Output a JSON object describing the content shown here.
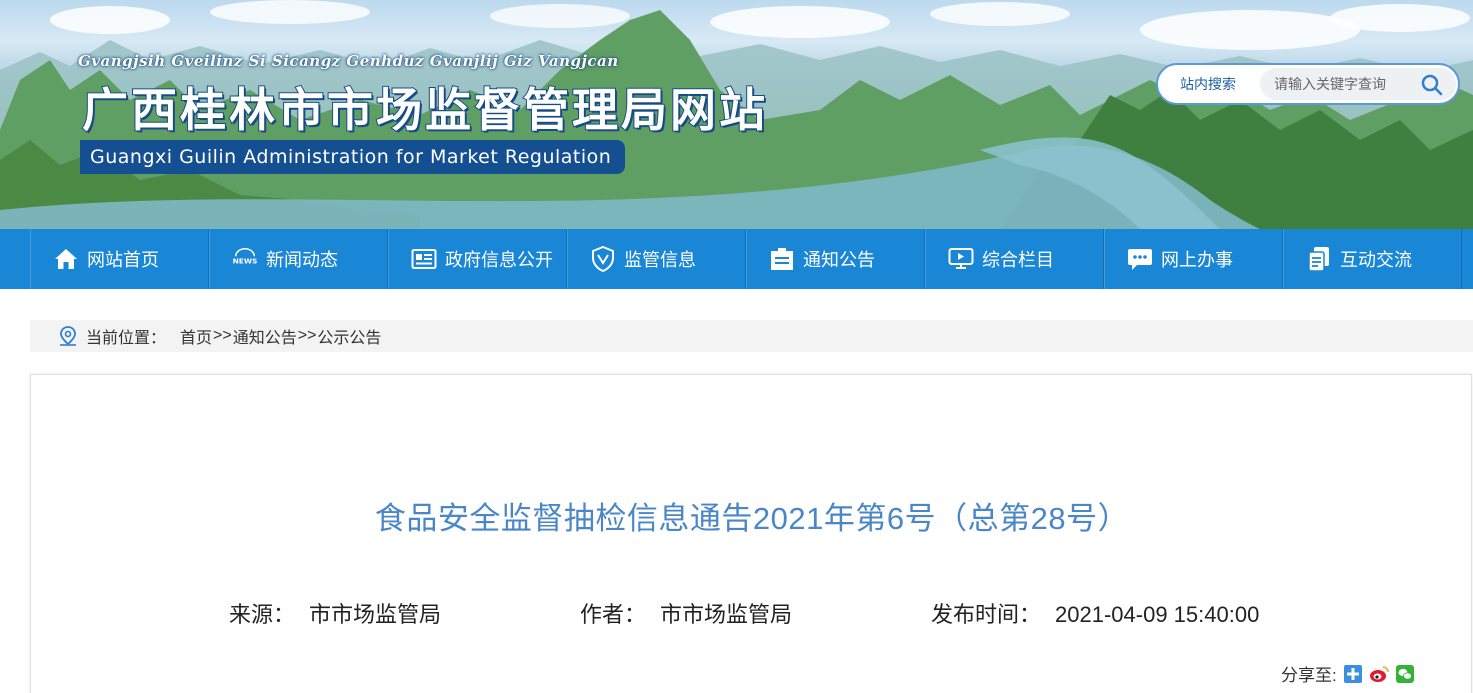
{
  "header": {
    "pinyin_title": "Gvangjsih Gveilinz Si Sicangz Genhduz Gvanjlij Giz Vangjcan",
    "site_title": "广西桂林市市场监督管理局网站",
    "english_title": "Guangxi Guilin Administration for Market Regulation"
  },
  "search": {
    "label": "站内搜索",
    "placeholder": "请输入关键字查询"
  },
  "nav": {
    "items": [
      {
        "label": "网站首页",
        "icon": "home-icon"
      },
      {
        "label": "新闻动态",
        "icon": "news-icon"
      },
      {
        "label": "政府信息公开",
        "icon": "document-icon"
      },
      {
        "label": "监管信息",
        "icon": "shield-icon"
      },
      {
        "label": "通知公告",
        "icon": "notice-icon"
      },
      {
        "label": "综合栏目",
        "icon": "monitor-icon"
      },
      {
        "label": "网上办事",
        "icon": "chat-icon"
      },
      {
        "label": "互动交流",
        "icon": "copy-icon"
      }
    ]
  },
  "breadcrumb": {
    "label": "当前位置：",
    "items": [
      "首页",
      "通知公告",
      "公示公告"
    ],
    "separator": ">>"
  },
  "article": {
    "title": "食品安全监督抽检信息通告2021年第6号（总第28号）",
    "source_label": "来源：",
    "source_value": "市市场监管局",
    "author_label": "作者：",
    "author_value": "市市场监管局",
    "time_label": "发布时间：",
    "time_value": "2021-04-09 15:40:00",
    "share_label": "分享至:",
    "share_icons": [
      "qzone-icon",
      "weibo-icon",
      "wechat-icon"
    ]
  },
  "colors": {
    "nav_bg": "#1a86d6",
    "title_blue": "#4a86c8",
    "banner_title_stroke": "#174b86"
  }
}
